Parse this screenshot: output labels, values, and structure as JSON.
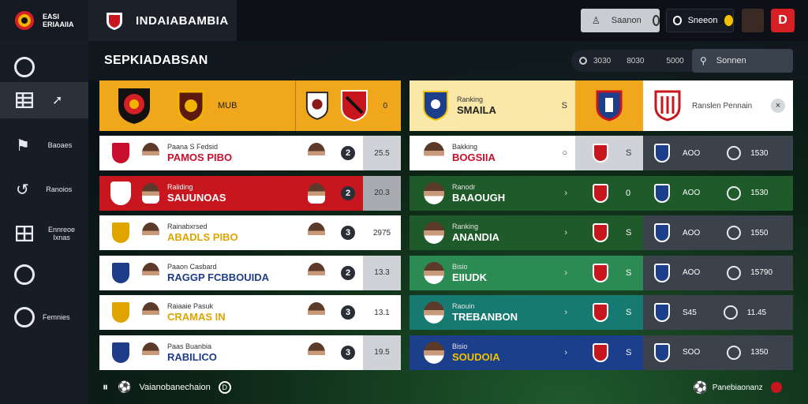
{
  "app": {
    "brand_name": "EASI ERIAAIIA",
    "title": "INDAIABAMBIA"
  },
  "topbar": {
    "btn1_label": "Saanon",
    "btn2_label": "Sneeon",
    "alert_label": "D"
  },
  "sidebar": {
    "items": [
      {
        "label": "",
        "icon": "shield-outline-icon"
      },
      {
        "label": "",
        "icon": "table-icon",
        "active": true
      },
      {
        "label": "Baoaes",
        "icon": "flag-icon"
      },
      {
        "label": "Ranoios",
        "icon": "refresh-icon"
      },
      {
        "label": "Ennreoe Ixnas",
        "icon": "grid-icon"
      },
      {
        "label": "",
        "icon": "circle-icon"
      },
      {
        "label": "Femnies",
        "icon": "badge-icon"
      }
    ]
  },
  "main": {
    "title": "SEPKIADABSAN",
    "stats": [
      "3030",
      "8030",
      "5000"
    ],
    "search_placeholder": "Sonnen"
  },
  "left_header": {
    "label": "MUB",
    "count": "0"
  },
  "right_header": {
    "title_sub": "Ranking",
    "title": "SMAILA",
    "flag": "S",
    "extra": "Ranslen Pennain",
    "close": "×"
  },
  "left_rows": [
    {
      "sub": "Paana S Fedsid",
      "name": "PAMOS PIBO",
      "rank": "2",
      "score": "25.5",
      "bg": "#ffffff",
      "fg": "#c8102e",
      "score_bg": "#cfd2d6"
    },
    {
      "sub": "Raliding",
      "name": "SAUUNOAS",
      "rank": "2",
      "score": "20.3",
      "bg": "#c8161e",
      "fg": "#ffffff",
      "score_bg": "#a8abb0"
    },
    {
      "sub": "Rainabxrsed",
      "name": "ABADLS PIBO",
      "rank": "3",
      "score": "2975",
      "bg": "#ffffff",
      "fg": "#e0a400",
      "score_bg": "#ffffff"
    },
    {
      "sub": "Paaon Casbard",
      "name": "RAGGP FCBBOUIDA",
      "rank": "2",
      "score": "13.3",
      "bg": "#ffffff",
      "fg": "#1f3c88",
      "score_bg": "#cfd2d6"
    },
    {
      "sub": "Raiaaie Pasuk",
      "name": "CRAMAS IN",
      "rank": "3",
      "score": "13.1",
      "bg": "#ffffff",
      "fg": "#e0a400",
      "score_bg": "#ffffff"
    },
    {
      "sub": "Paas Buanbia",
      "name": "RABILICO",
      "rank": "3",
      "score": "19.5",
      "bg": "#ffffff",
      "fg": "#1f3c88",
      "score_bg": "#cfd2d6"
    }
  ],
  "right_rows": [
    {
      "sub": "Bakking",
      "name": "BOGSIIA",
      "chev": "○",
      "badge": "S",
      "stat": "AOO",
      "val": "1530",
      "bg": "#ffffff",
      "fg": "#c8102e",
      "mid_bg": "#cfd2d6",
      "end_bg": "#3c424b"
    },
    {
      "sub": "Ranodr",
      "name": "BAAOUGH",
      "chev": "›",
      "badge": "0",
      "stat": "AOO",
      "val": "1530",
      "bg": "#1e5a2a",
      "fg": "#ffffff",
      "mid_bg": "#1e5a2a",
      "end_bg": "#1e5a2a"
    },
    {
      "sub": "Ranking",
      "name": "ANANDIA",
      "chev": "›",
      "badge": "S",
      "stat": "AOO",
      "val": "1550",
      "bg": "#1e5a2a",
      "fg": "#ffffff",
      "mid_bg": "#1e5a2a",
      "end_bg": "#3c424b"
    },
    {
      "sub": "Bisio",
      "name": "EIIUDK",
      "chev": "›",
      "badge": "S",
      "stat": "AOO",
      "val": "15790",
      "bg": "#2c8b52",
      "fg": "#ffffff",
      "mid_bg": "#2c8b52",
      "end_bg": "#3c424b"
    },
    {
      "sub": "Raouin",
      "name": "TREBANBON",
      "chev": "›",
      "badge": "S",
      "stat": "S45",
      "val": "11.45",
      "bg": "#167a72",
      "fg": "#ffffff",
      "mid_bg": "#167a72",
      "end_bg": "#3c424b"
    },
    {
      "sub": "Bisio",
      "name": "SOUDOIA",
      "chev": "›",
      "badge": "S",
      "stat": "SOO",
      "val": "1350",
      "bg": "#1b3f8a",
      "fg": "#f2c200",
      "mid_bg": "#1b3f8a",
      "end_bg": "#3c424b"
    }
  ],
  "footer": {
    "left_label": "Vaianobanechaion",
    "left_badge": "D",
    "right_label": "Panebiaonanz"
  }
}
